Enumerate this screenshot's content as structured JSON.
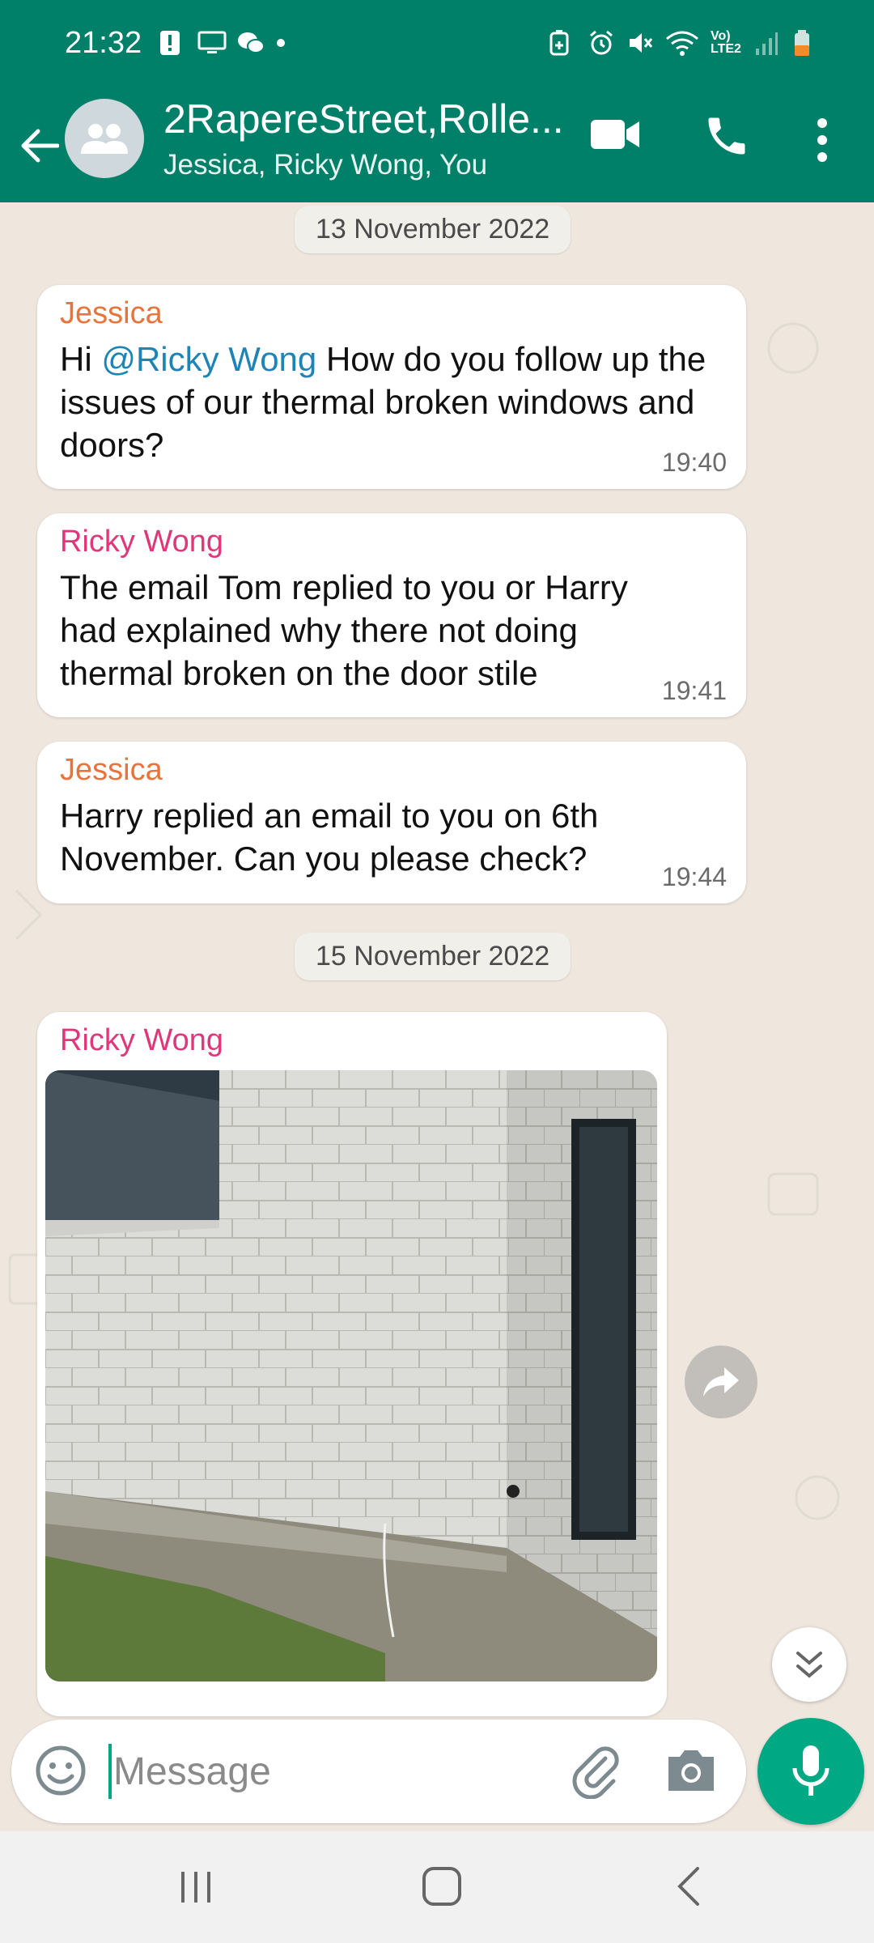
{
  "status_bar": {
    "time": "21:32",
    "icons_left": [
      "alert-icon",
      "monitor-icon",
      "wechat-icon",
      "dot-icon"
    ],
    "icons_right": [
      "battery-saver-icon",
      "alarm-icon",
      "mute-icon",
      "wifi-icon",
      "volte-icon",
      "signal-icon",
      "battery-icon"
    ],
    "volte_label": "Vo) LTE2"
  },
  "header": {
    "title": "2RapereStreet,Rolle...",
    "subtitle": "Jessica, Ricky Wong, You",
    "accent_color": "#008069"
  },
  "chat": {
    "date_chips": [
      "13 November 2022",
      "15 November 2022"
    ],
    "messages": [
      {
        "sender": "Jessica",
        "mention": "@Ricky Wong",
        "text_after_mention": " How do you follow up the issues of our thermal broken windows and doors?",
        "prefix": "Hi ",
        "time": "19:40"
      },
      {
        "sender": "Ricky Wong",
        "text": "The email Tom replied to you or Harry had explained why there not doing thermal broken on the door stile",
        "time": "19:41"
      },
      {
        "sender": "Jessica",
        "text": "Harry replied an email to you on 6th November. Can you please check?",
        "time": "19:44"
      },
      {
        "sender": "Ricky Wong",
        "type": "image",
        "image_description": "brick-wall-corner-photo"
      }
    ]
  },
  "input": {
    "placeholder": "Message"
  }
}
